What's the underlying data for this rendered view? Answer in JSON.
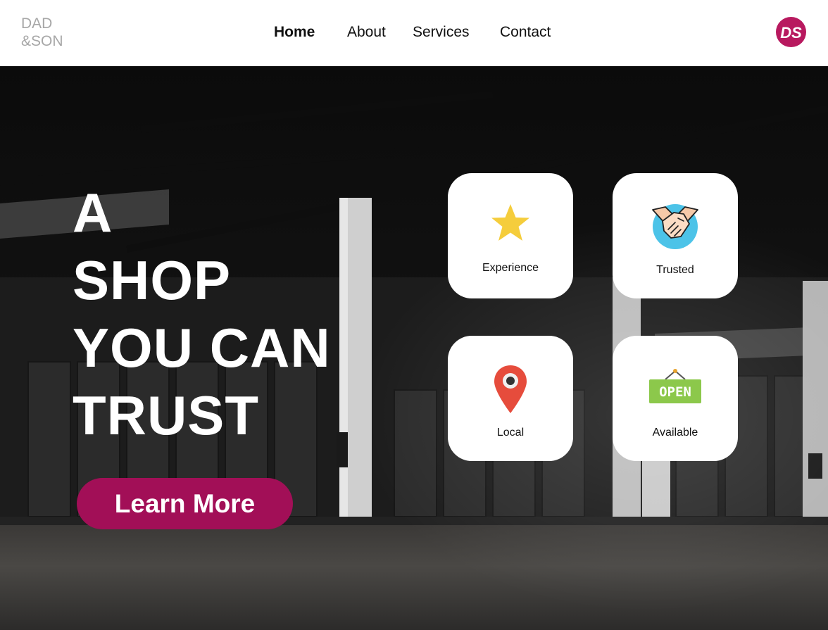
{
  "brand": {
    "line1": "DAD",
    "line2": "&SON",
    "color": "#a7a7a7"
  },
  "nav": {
    "items": [
      {
        "label": "Home",
        "active": true
      },
      {
        "label": "About",
        "active": false
      },
      {
        "label": "Services",
        "active": false
      },
      {
        "label": "Contact",
        "active": false
      }
    ]
  },
  "logo": {
    "text": "DS",
    "color": "#b8195f",
    "icon": "ds-logo-icon"
  },
  "hero": {
    "headline": [
      "A",
      "SHOP",
      "YOU CAN",
      "TRUST"
    ],
    "cta_label": "Learn More",
    "cta_color": "#a20f57",
    "background": "dark-warehouse-photo"
  },
  "features": [
    {
      "label": "Experience",
      "icon": "star-icon"
    },
    {
      "label": "Trusted",
      "icon": "handshake-icon"
    },
    {
      "label": "Local",
      "icon": "location-pin-icon"
    },
    {
      "label": "Available",
      "icon": "open-sign-icon",
      "sign_text": "OPEN"
    }
  ]
}
